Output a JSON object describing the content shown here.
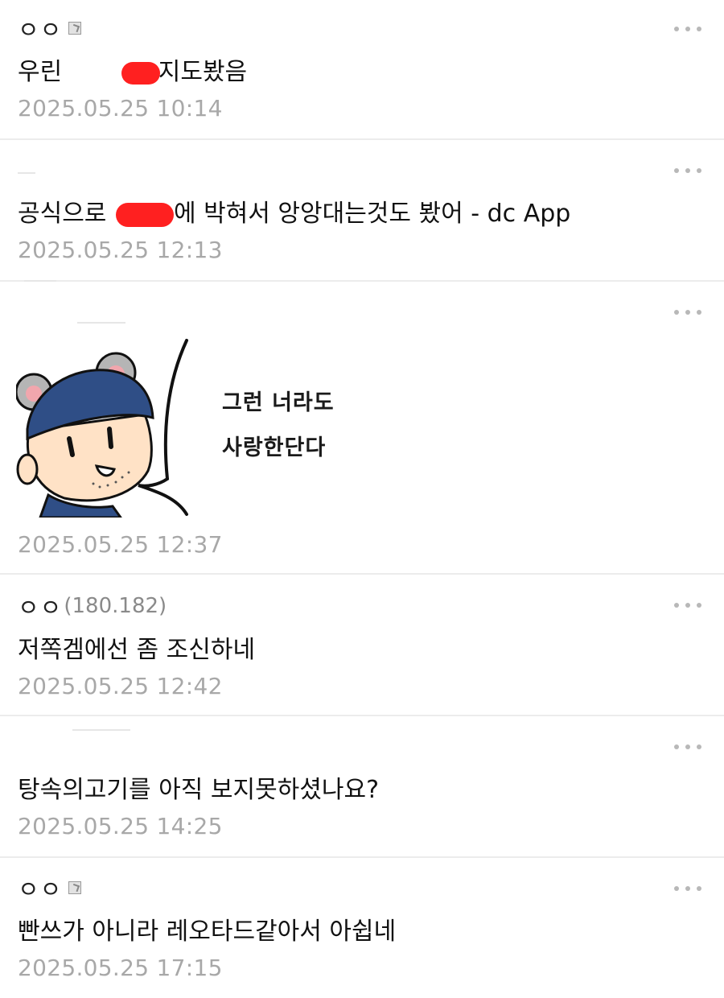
{
  "comments": [
    {
      "author": "ㅇㅇ",
      "text_before": "우린 ",
      "text_after": "지도봤음",
      "time": "2025.05.25 10:14"
    },
    {
      "text_before": "공식으로 ",
      "text_after": "에 박혀서 앙앙대는것도 봤어 - dc App",
      "time": "2025.05.25 12:13"
    },
    {
      "sticker_lines": [
        "그런 너라도",
        "사랑한단다"
      ],
      "time": "2025.05.25 12:37"
    },
    {
      "author": "ㅇㅇ",
      "ip": "(180.182)",
      "text": "저쪽겜에선 좀 조신하네",
      "time": "2025.05.25 12:42"
    },
    {
      "text": "탕속의고기를 아직 보지못하셨나요?",
      "time": "2025.05.25 14:25"
    },
    {
      "author": "ㅇㅇ",
      "text": "빤쓰가 아니라 레오타드같아서 아쉽네",
      "time": "2025.05.25 17:15"
    }
  ],
  "colors": {
    "redaction": "#ff2020",
    "timestamp": "#a8a8a8",
    "divider": "#ececec"
  },
  "icons": {
    "more": "more-dots-icon",
    "badge": "fixed-nick-badge-icon"
  }
}
